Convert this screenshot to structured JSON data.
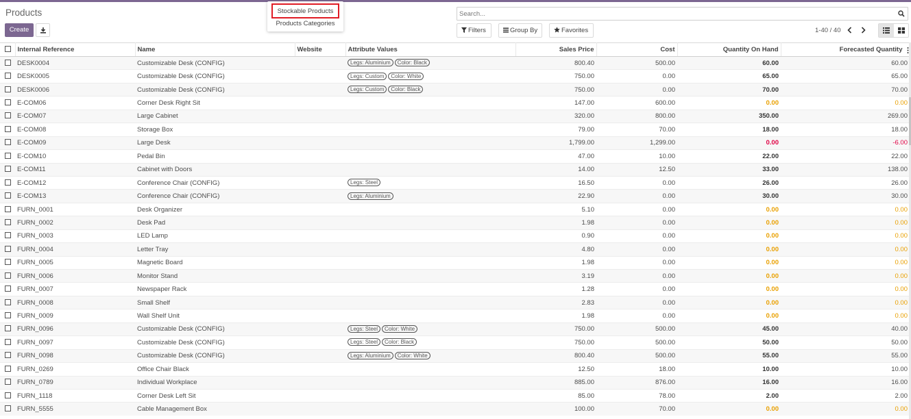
{
  "page": {
    "title": "Products",
    "create_label": "Create",
    "accent_color": "#7c6791"
  },
  "dropdown": {
    "items": [
      "Stockable Products",
      "Products Categories"
    ],
    "highlight_color": "#e01b24"
  },
  "search": {
    "placeholder": "Search..."
  },
  "filters": {
    "filters_label": "Filters",
    "groupby_label": "Group By",
    "favorites_label": "Favorites"
  },
  "pager": {
    "range": "1-40 / 40"
  },
  "table": {
    "columns": [
      "Internal Reference",
      "Name",
      "Website",
      "Attribute Values",
      "Sales Price",
      "Cost",
      "Quantity On Hand",
      "Forecasted Quantity"
    ],
    "rows": [
      {
        "ref": "DESK0004",
        "name": "Customizable Desk (CONFIG)",
        "website": "",
        "attrs": [
          "Legs: Aluminium",
          "Color: Black"
        ],
        "price": "800.40",
        "cost": "500.00",
        "onhand": "60.00",
        "forecast": "60.00",
        "status": "normal"
      },
      {
        "ref": "DESK0005",
        "name": "Customizable Desk (CONFIG)",
        "website": "",
        "attrs": [
          "Legs: Custom",
          "Color: White"
        ],
        "price": "750.00",
        "cost": "0.00",
        "onhand": "65.00",
        "forecast": "65.00",
        "status": "normal"
      },
      {
        "ref": "DESK0006",
        "name": "Customizable Desk (CONFIG)",
        "website": "",
        "attrs": [
          "Legs: Custom",
          "Color: Black"
        ],
        "price": "750.00",
        "cost": "0.00",
        "onhand": "70.00",
        "forecast": "70.00",
        "status": "normal"
      },
      {
        "ref": "E-COM06",
        "name": "Corner Desk Right Sit",
        "website": "",
        "attrs": [],
        "price": "147.00",
        "cost": "600.00",
        "onhand": "0.00",
        "forecast": "0.00",
        "status": "warn"
      },
      {
        "ref": "E-COM07",
        "name": "Large Cabinet",
        "website": "",
        "attrs": [],
        "price": "320.00",
        "cost": "800.00",
        "onhand": "350.00",
        "forecast": "269.00",
        "status": "normal"
      },
      {
        "ref": "E-COM08",
        "name": "Storage Box",
        "website": "",
        "attrs": [],
        "price": "79.00",
        "cost": "70.00",
        "onhand": "18.00",
        "forecast": "18.00",
        "status": "normal"
      },
      {
        "ref": "E-COM09",
        "name": "Large Desk",
        "website": "",
        "attrs": [],
        "price": "1,799.00",
        "cost": "1,299.00",
        "onhand": "0.00",
        "forecast": "-6.00",
        "status": "neg"
      },
      {
        "ref": "E-COM10",
        "name": "Pedal Bin",
        "website": "",
        "attrs": [],
        "price": "47.00",
        "cost": "10.00",
        "onhand": "22.00",
        "forecast": "22.00",
        "status": "normal"
      },
      {
        "ref": "E-COM11",
        "name": "Cabinet with Doors",
        "website": "",
        "attrs": [],
        "price": "14.00",
        "cost": "12.50",
        "onhand": "33.00",
        "forecast": "138.00",
        "status": "normal"
      },
      {
        "ref": "E-COM12",
        "name": "Conference Chair (CONFIG)",
        "website": "",
        "attrs": [
          "Legs: Steel"
        ],
        "price": "16.50",
        "cost": "0.00",
        "onhand": "26.00",
        "forecast": "26.00",
        "status": "normal"
      },
      {
        "ref": "E-COM13",
        "name": "Conference Chair (CONFIG)",
        "website": "",
        "attrs": [
          "Legs: Aluminium"
        ],
        "price": "22.90",
        "cost": "0.00",
        "onhand": "30.00",
        "forecast": "30.00",
        "status": "normal"
      },
      {
        "ref": "FURN_0001",
        "name": "Desk Organizer",
        "website": "",
        "attrs": [],
        "price": "5.10",
        "cost": "0.00",
        "onhand": "0.00",
        "forecast": "0.00",
        "status": "warn"
      },
      {
        "ref": "FURN_0002",
        "name": "Desk Pad",
        "website": "",
        "attrs": [],
        "price": "1.98",
        "cost": "0.00",
        "onhand": "0.00",
        "forecast": "0.00",
        "status": "warn"
      },
      {
        "ref": "FURN_0003",
        "name": "LED Lamp",
        "website": "",
        "attrs": [],
        "price": "0.90",
        "cost": "0.00",
        "onhand": "0.00",
        "forecast": "0.00",
        "status": "warn"
      },
      {
        "ref": "FURN_0004",
        "name": "Letter Tray",
        "website": "",
        "attrs": [],
        "price": "4.80",
        "cost": "0.00",
        "onhand": "0.00",
        "forecast": "0.00",
        "status": "warn"
      },
      {
        "ref": "FURN_0005",
        "name": "Magnetic Board",
        "website": "",
        "attrs": [],
        "price": "1.98",
        "cost": "0.00",
        "onhand": "0.00",
        "forecast": "0.00",
        "status": "warn"
      },
      {
        "ref": "FURN_0006",
        "name": "Monitor Stand",
        "website": "",
        "attrs": [],
        "price": "3.19",
        "cost": "0.00",
        "onhand": "0.00",
        "forecast": "0.00",
        "status": "warn"
      },
      {
        "ref": "FURN_0007",
        "name": "Newspaper Rack",
        "website": "",
        "attrs": [],
        "price": "1.28",
        "cost": "0.00",
        "onhand": "0.00",
        "forecast": "0.00",
        "status": "warn"
      },
      {
        "ref": "FURN_0008",
        "name": "Small Shelf",
        "website": "",
        "attrs": [],
        "price": "2.83",
        "cost": "0.00",
        "onhand": "0.00",
        "forecast": "0.00",
        "status": "warn"
      },
      {
        "ref": "FURN_0009",
        "name": "Wall Shelf Unit",
        "website": "",
        "attrs": [],
        "price": "1.98",
        "cost": "0.00",
        "onhand": "0.00",
        "forecast": "0.00",
        "status": "warn"
      },
      {
        "ref": "FURN_0096",
        "name": "Customizable Desk (CONFIG)",
        "website": "",
        "attrs": [
          "Legs: Steel",
          "Color: White"
        ],
        "price": "750.00",
        "cost": "500.00",
        "onhand": "45.00",
        "forecast": "40.00",
        "status": "normal"
      },
      {
        "ref": "FURN_0097",
        "name": "Customizable Desk (CONFIG)",
        "website": "",
        "attrs": [
          "Legs: Steel",
          "Color: Black"
        ],
        "price": "750.00",
        "cost": "500.00",
        "onhand": "50.00",
        "forecast": "50.00",
        "status": "normal"
      },
      {
        "ref": "FURN_0098",
        "name": "Customizable Desk (CONFIG)",
        "website": "",
        "attrs": [
          "Legs: Aluminium",
          "Color: White"
        ],
        "price": "800.40",
        "cost": "500.00",
        "onhand": "55.00",
        "forecast": "55.00",
        "status": "normal"
      },
      {
        "ref": "FURN_0269",
        "name": "Office Chair Black",
        "website": "",
        "attrs": [],
        "price": "12.50",
        "cost": "18.00",
        "onhand": "10.00",
        "forecast": "10.00",
        "status": "normal"
      },
      {
        "ref": "FURN_0789",
        "name": "Individual Workplace",
        "website": "",
        "attrs": [],
        "price": "885.00",
        "cost": "876.00",
        "onhand": "16.00",
        "forecast": "16.00",
        "status": "normal"
      },
      {
        "ref": "FURN_1118",
        "name": "Corner Desk Left Sit",
        "website": "",
        "attrs": [],
        "price": "85.00",
        "cost": "78.00",
        "onhand": "2.00",
        "forecast": "2.00",
        "status": "normal"
      },
      {
        "ref": "FURN_5555",
        "name": "Cable Management Box",
        "website": "",
        "attrs": [],
        "price": "100.00",
        "cost": "70.00",
        "onhand": "0.00",
        "forecast": "0.00",
        "status": "warn"
      }
    ]
  }
}
